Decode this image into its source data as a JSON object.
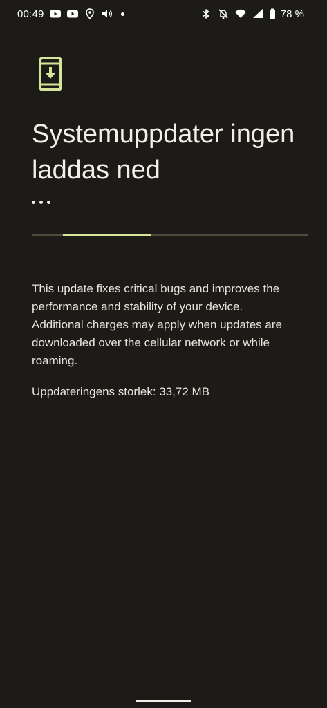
{
  "status_bar": {
    "time": "00:49",
    "battery_percent": "78 %",
    "left_icons": [
      "youtube-icon",
      "youtube-icon",
      "location-icon",
      "volume-icon",
      "notification-dot"
    ],
    "right_icons": [
      "bluetooth-icon",
      "notifications-off-icon",
      "wifi-icon",
      "cellular-icon",
      "battery-icon"
    ]
  },
  "main": {
    "icon": "system-update-icon",
    "title": "Systemuppdater ingen laddas ned",
    "ellipsis": "...",
    "progress_fraction": 0.32,
    "description": "This update fixes critical bugs and improves the performance and stability of your device. Additional charges may apply when updates are downloaded over the cellular network or while roaming.",
    "size_label": "Uppdateringens storlek: 33,72 MB"
  },
  "colors": {
    "background": "#1c1b17",
    "accent": "#d8e49a",
    "track": "#4d4d3c",
    "text": "#e6e3da"
  }
}
